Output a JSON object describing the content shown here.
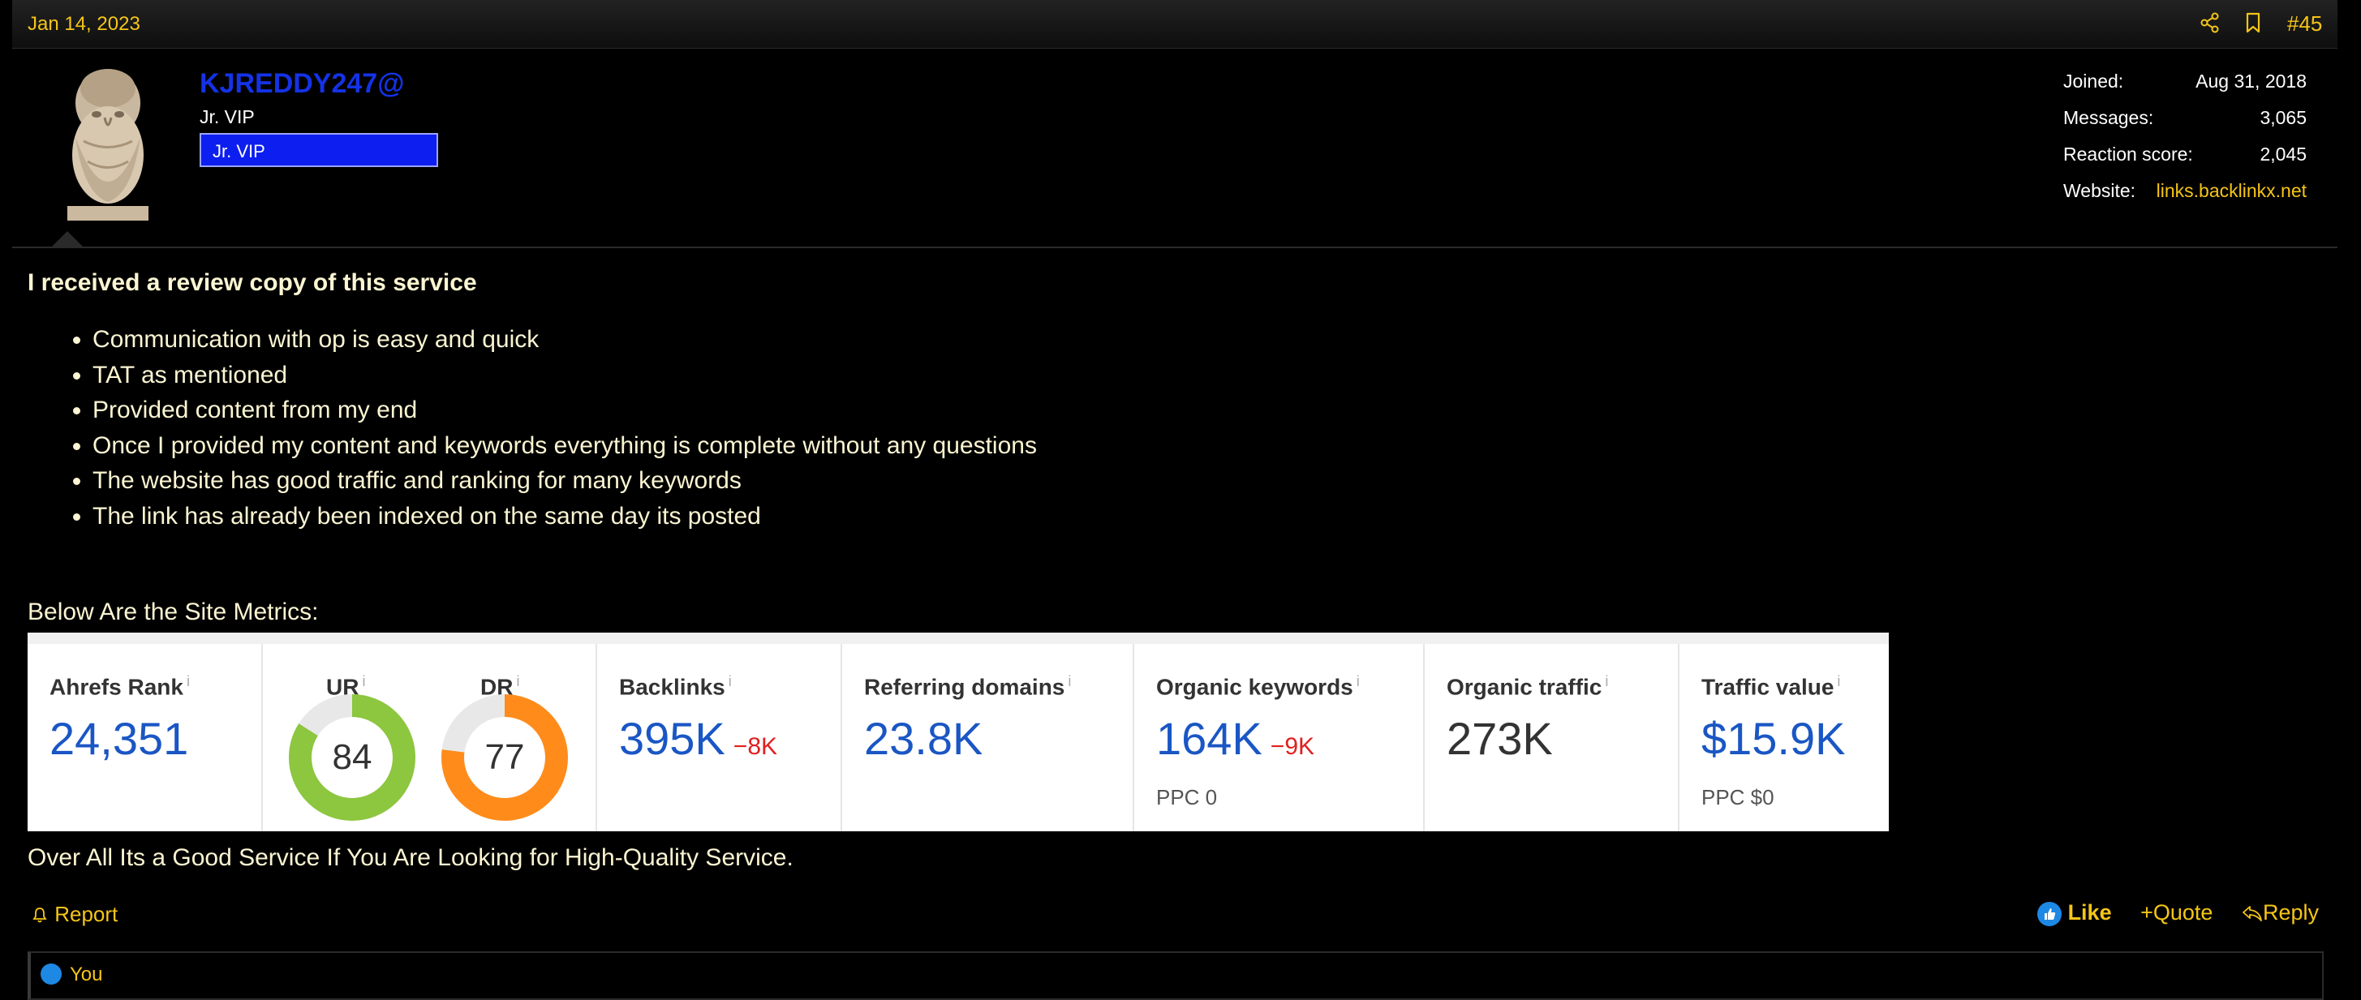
{
  "header": {
    "date": "Jan 14, 2023",
    "post_number": "#45",
    "icons": [
      "share-icon",
      "bookmark-icon"
    ]
  },
  "user": {
    "name": "KJREDDY247@",
    "title": "Jr. VIP",
    "banner": "Jr. VIP",
    "stats": [
      {
        "label": "Joined:",
        "value": "Aug 31, 2018"
      },
      {
        "label": "Messages:",
        "value": "3,065"
      },
      {
        "label": "Reaction score:",
        "value": "2,045"
      },
      {
        "label": "Website:",
        "value": "links.backlinkx.net"
      }
    ]
  },
  "post": {
    "heading": "I received a review copy of this service",
    "bullets": [
      "Communication with op is easy and quick",
      "TAT as mentioned",
      "Provided content from my end",
      "Once I provided my content and keywords everything is complete without any questions",
      "The website has good traffic and ranking for many keywords",
      "The link has already been indexed on the same day its posted"
    ],
    "metrics_label": "Below Are the Site Metrics:",
    "summary": "Over All Its a Good Service If You Are Looking for High-Quality Service."
  },
  "metrics": {
    "ahrefs_rank": {
      "title": "Ahrefs Rank",
      "value": "24,351"
    },
    "ur": {
      "title": "UR",
      "value": "84",
      "percent": 84,
      "color": "#8dc63f"
    },
    "dr": {
      "title": "DR",
      "value": "77",
      "percent": 77,
      "color": "#ff8c1a"
    },
    "backlinks": {
      "title": "Backlinks",
      "value": "395K",
      "delta": "−8K"
    },
    "referring_domains": {
      "title": "Referring domains",
      "value": "23.8K"
    },
    "organic_keywords": {
      "title": "Organic keywords",
      "value": "164K",
      "delta": "−9K",
      "sub": "PPC 0"
    },
    "organic_traffic": {
      "title": "Organic traffic",
      "value": "273K"
    },
    "traffic_value": {
      "title": "Traffic value",
      "value": "$15.9K",
      "sub": "PPC $0"
    },
    "info_mark": "i"
  },
  "actions": {
    "report": "Report",
    "like": "Like",
    "quote": "Quote",
    "reply": "Reply"
  },
  "reactions": {
    "text": "You"
  },
  "colors": {
    "accent": "#f5c518",
    "username": "#1432e6",
    "metric_blue": "#1a56c4",
    "negative": "#e02020"
  }
}
